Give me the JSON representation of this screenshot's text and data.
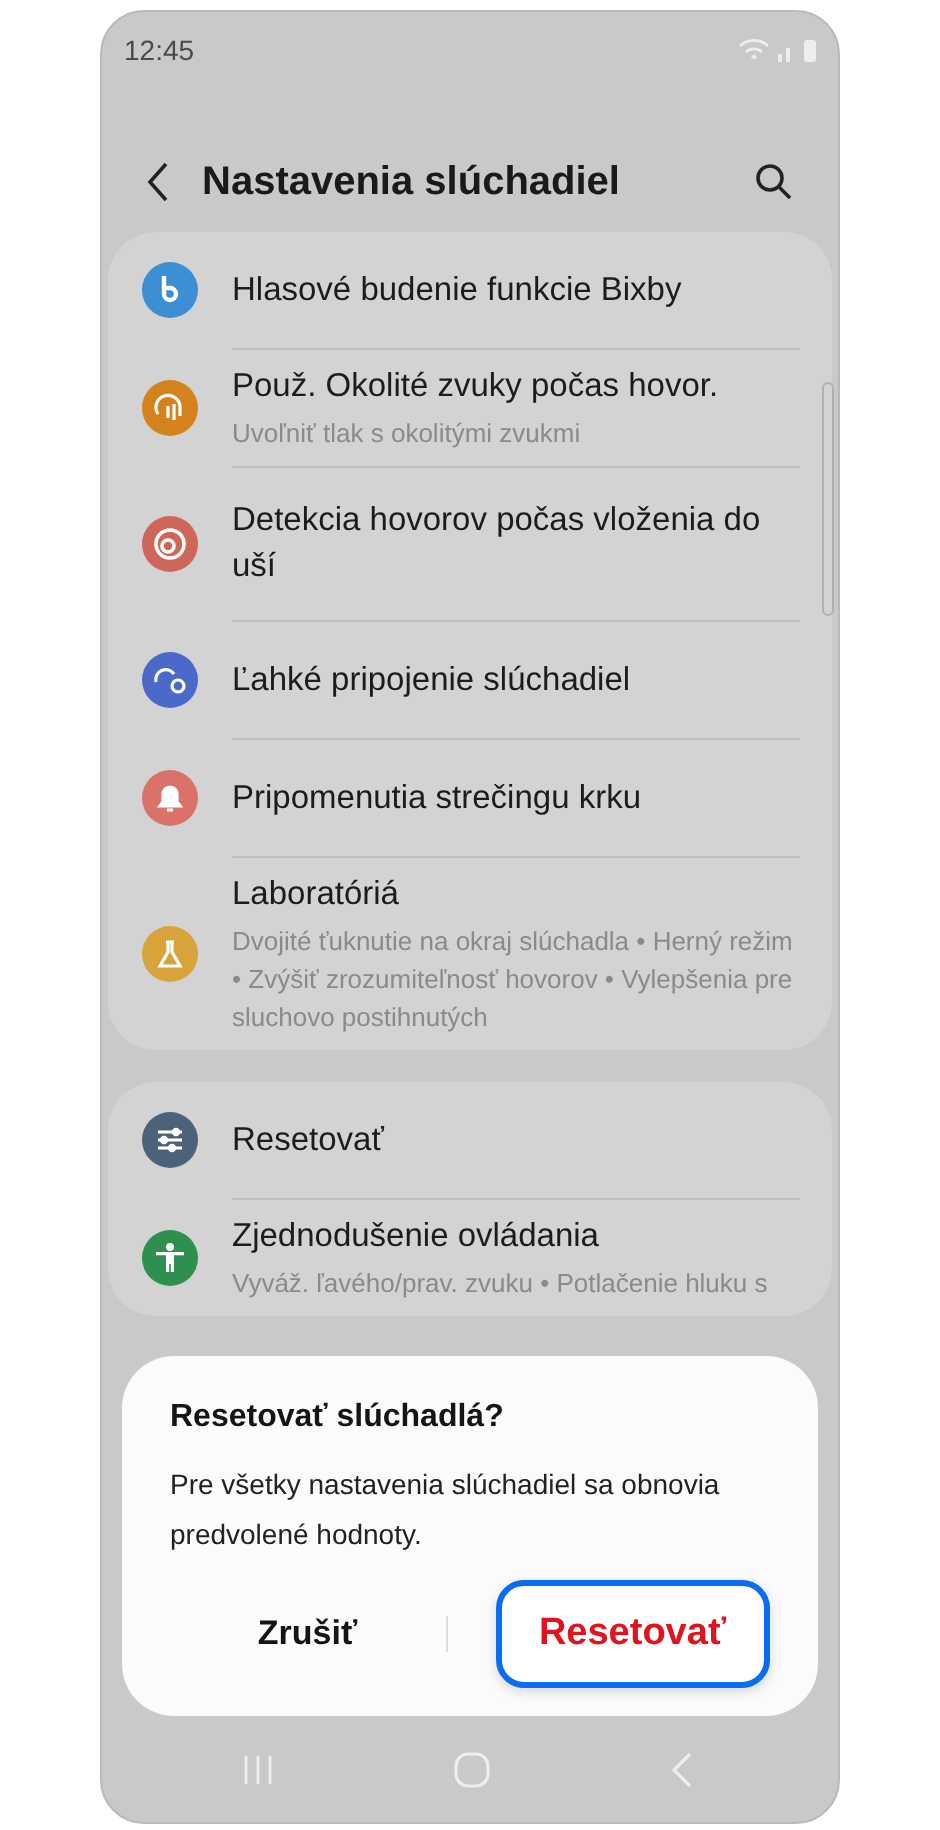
{
  "status_bar": {
    "time": "12:45"
  },
  "header": {
    "title": "Nastavenia slúchadiel"
  },
  "groups": [
    {
      "items": [
        {
          "title": "Hlasové budenie funkcie Bixby",
          "color": "#3b8fd2",
          "kind": "bixby"
        },
        {
          "title": "Použ. Okolité zvuky počas hovor.",
          "subtitle": "Uvoľniť tlak s okolitými zvukmi",
          "color": "#d4831c",
          "kind": "sound"
        },
        {
          "title": "Detekcia hovorov počas vloženia do uší",
          "color": "#cf665a",
          "kind": "ear"
        },
        {
          "title": "Ľahké pripojenie slúchadiel",
          "color": "#4a69c9",
          "kind": "sync"
        },
        {
          "title": "Pripomenutia strečingu krku",
          "color": "#d9736a",
          "kind": "bell"
        },
        {
          "title": "Laboratóriá",
          "subtitle": "Dvojité ťuknutie na okraj slúchadla  •  Herný režim  •  Zvýšiť zrozumiteľnosť hovorov  •  Vylepšenia pre sluchovo postihnutých",
          "color": "#d9a33c",
          "kind": "flask"
        }
      ]
    },
    {
      "items": [
        {
          "title": "Resetovať",
          "color": "#4c6278",
          "kind": "sliders"
        },
        {
          "title": "Zjednodušenie ovládania",
          "subtitle": "Vyváž. ľavého/prav. zvuku  •  Potlačenie hluku s",
          "color": "#2f8f4f",
          "kind": "person"
        }
      ]
    }
  ],
  "dialog": {
    "title": "Resetovať slúchadlá?",
    "message": "Pre všetky nastavenia slúchadiel sa obnovia predvolené hodnoty.",
    "buttons": [
      {
        "label": "Zrušiť",
        "kind": "cancel",
        "focused": false
      },
      {
        "label": "Resetovať",
        "kind": "confirm",
        "focused": true
      }
    ]
  }
}
